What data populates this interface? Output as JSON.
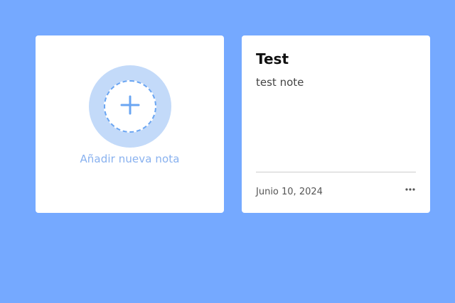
{
  "add_card": {
    "label": "Añadir nueva nota",
    "icon": "plus-icon"
  },
  "notes": [
    {
      "title": "Test",
      "body": "test note",
      "date": "Junio 10, 2024",
      "menu_icon": "more-dots-icon"
    }
  ],
  "colors": {
    "background": "#75a9ff",
    "accent": "#6aa5f2",
    "accent_light": "#c3daf9",
    "card": "#ffffff"
  }
}
